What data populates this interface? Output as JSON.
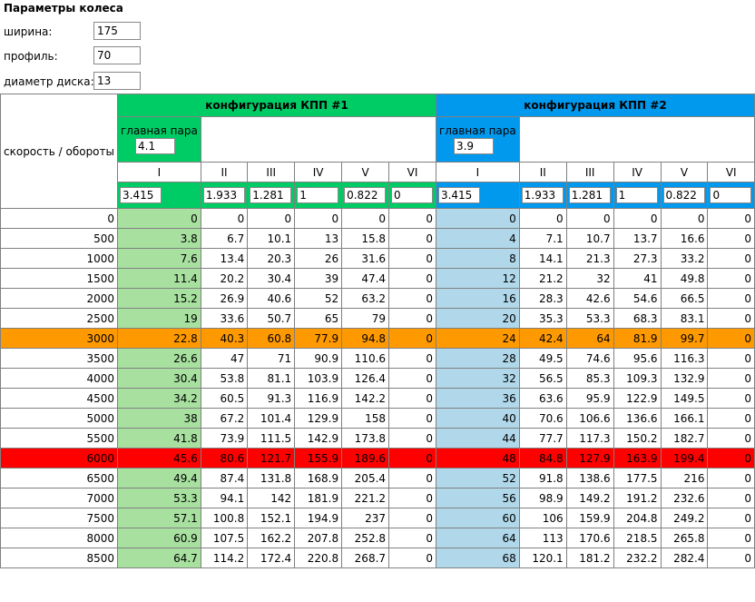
{
  "title": "Параметры колеса",
  "params": [
    {
      "label": "ширина:",
      "value": "175"
    },
    {
      "label": "профиль:",
      "value": "70"
    },
    {
      "label": "диаметр диска:",
      "value": "13"
    }
  ],
  "table": {
    "corner_label": "скорость / обороты",
    "config1": {
      "title": "конфигурация КПП #1",
      "main_pair_label": "главная пара",
      "main_pair_value": "4.1",
      "gears": [
        "I",
        "II",
        "III",
        "IV",
        "V",
        "VI"
      ],
      "ratios": [
        "3.415",
        "1.933",
        "1.281",
        "1",
        "0.822",
        "0"
      ]
    },
    "config2": {
      "title": "конфигурация КПП #2",
      "main_pair_label": "главная пара",
      "main_pair_value": "3.9",
      "gears": [
        "I",
        "II",
        "III",
        "IV",
        "V",
        "VI"
      ],
      "ratios": [
        "3.415",
        "1.933",
        "1.281",
        "1",
        "0.822",
        "0"
      ]
    },
    "rows": [
      {
        "rpm": "0",
        "c1": [
          "0",
          "0",
          "0",
          "0",
          "0",
          "0"
        ],
        "c2": [
          "0",
          "0",
          "0",
          "0",
          "0",
          "0"
        ]
      },
      {
        "rpm": "500",
        "c1": [
          "3.8",
          "6.7",
          "10.1",
          "13",
          "15.8",
          "0"
        ],
        "c2": [
          "4",
          "7.1",
          "10.7",
          "13.7",
          "16.6",
          "0"
        ]
      },
      {
        "rpm": "1000",
        "c1": [
          "7.6",
          "13.4",
          "20.3",
          "26",
          "31.6",
          "0"
        ],
        "c2": [
          "8",
          "14.1",
          "21.3",
          "27.3",
          "33.2",
          "0"
        ]
      },
      {
        "rpm": "1500",
        "c1": [
          "11.4",
          "20.2",
          "30.4",
          "39",
          "47.4",
          "0"
        ],
        "c2": [
          "12",
          "21.2",
          "32",
          "41",
          "49.8",
          "0"
        ]
      },
      {
        "rpm": "2000",
        "c1": [
          "15.2",
          "26.9",
          "40.6",
          "52",
          "63.2",
          "0"
        ],
        "c2": [
          "16",
          "28.3",
          "42.6",
          "54.6",
          "66.5",
          "0"
        ]
      },
      {
        "rpm": "2500",
        "c1": [
          "19",
          "33.6",
          "50.7",
          "65",
          "79",
          "0"
        ],
        "c2": [
          "20",
          "35.3",
          "53.3",
          "68.3",
          "83.1",
          "0"
        ]
      },
      {
        "rpm": "3000",
        "c1": [
          "22.8",
          "40.3",
          "60.8",
          "77.9",
          "94.8",
          "0"
        ],
        "c2": [
          "24",
          "42.4",
          "64",
          "81.9",
          "99.7",
          "0"
        ],
        "hl": "orange"
      },
      {
        "rpm": "3500",
        "c1": [
          "26.6",
          "47",
          "71",
          "90.9",
          "110.6",
          "0"
        ],
        "c2": [
          "28",
          "49.5",
          "74.6",
          "95.6",
          "116.3",
          "0"
        ]
      },
      {
        "rpm": "4000",
        "c1": [
          "30.4",
          "53.8",
          "81.1",
          "103.9",
          "126.4",
          "0"
        ],
        "c2": [
          "32",
          "56.5",
          "85.3",
          "109.3",
          "132.9",
          "0"
        ]
      },
      {
        "rpm": "4500",
        "c1": [
          "34.2",
          "60.5",
          "91.3",
          "116.9",
          "142.2",
          "0"
        ],
        "c2": [
          "36",
          "63.6",
          "95.9",
          "122.9",
          "149.5",
          "0"
        ]
      },
      {
        "rpm": "5000",
        "c1": [
          "38",
          "67.2",
          "101.4",
          "129.9",
          "158",
          "0"
        ],
        "c2": [
          "40",
          "70.6",
          "106.6",
          "136.6",
          "166.1",
          "0"
        ]
      },
      {
        "rpm": "5500",
        "c1": [
          "41.8",
          "73.9",
          "111.5",
          "142.9",
          "173.8",
          "0"
        ],
        "c2": [
          "44",
          "77.7",
          "117.3",
          "150.2",
          "182.7",
          "0"
        ]
      },
      {
        "rpm": "6000",
        "c1": [
          "45.6",
          "80.6",
          "121.7",
          "155.9",
          "189.6",
          "0"
        ],
        "c2": [
          "48",
          "84.8",
          "127.9",
          "163.9",
          "199.4",
          "0"
        ],
        "hl": "red"
      },
      {
        "rpm": "6500",
        "c1": [
          "49.4",
          "87.4",
          "131.8",
          "168.9",
          "205.4",
          "0"
        ],
        "c2": [
          "52",
          "91.8",
          "138.6",
          "177.5",
          "216",
          "0"
        ]
      },
      {
        "rpm": "7000",
        "c1": [
          "53.3",
          "94.1",
          "142",
          "181.9",
          "221.2",
          "0"
        ],
        "c2": [
          "56",
          "98.9",
          "149.2",
          "191.2",
          "232.6",
          "0"
        ]
      },
      {
        "rpm": "7500",
        "c1": [
          "57.1",
          "100.8",
          "152.1",
          "194.9",
          "237",
          "0"
        ],
        "c2": [
          "60",
          "106",
          "159.9",
          "204.8",
          "249.2",
          "0"
        ]
      },
      {
        "rpm": "8000",
        "c1": [
          "60.9",
          "107.5",
          "162.2",
          "207.8",
          "252.8",
          "0"
        ],
        "c2": [
          "64",
          "113",
          "170.6",
          "218.5",
          "265.8",
          "0"
        ]
      },
      {
        "rpm": "8500",
        "c1": [
          "64.7",
          "114.2",
          "172.4",
          "220.8",
          "268.7",
          "0"
        ],
        "c2": [
          "68",
          "120.1",
          "181.2",
          "232.2",
          "282.4",
          "0"
        ]
      }
    ]
  },
  "colors": {
    "config1_accent": "#00cc66",
    "config2_accent": "#0099ee",
    "gear1_col1": "#a8e0a0",
    "gear1_col2": "#b0d8ea",
    "highlight_orange": "#ff9900",
    "highlight_red": "#ff0000"
  }
}
